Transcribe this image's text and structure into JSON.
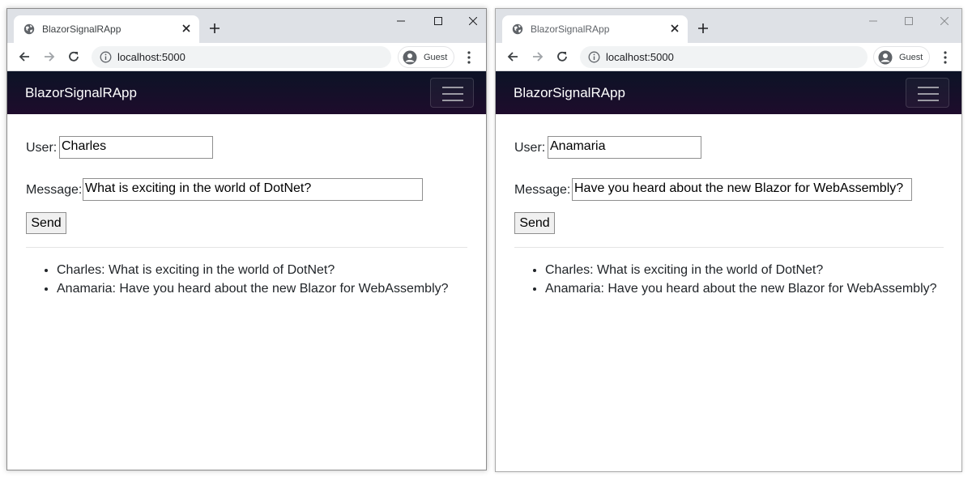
{
  "windows": [
    {
      "tab": {
        "title": "BlazorSignalRApp"
      },
      "url": "localhost:5000",
      "profile": "Guest",
      "app": {
        "brand": "BlazorSignalRApp",
        "user_label": "User:",
        "user_value": "Charles",
        "message_label": "Message:",
        "message_value": "What is exciting in the world of DotNet?",
        "send_label": "Send"
      },
      "messages": [
        "Charles: What is exciting in the world of DotNet?",
        "Anamaria: Have you heard about the new Blazor for WebAssembly?"
      ]
    },
    {
      "tab": {
        "title": "BlazorSignalRApp"
      },
      "url": "localhost:5000",
      "profile": "Guest",
      "app": {
        "brand": "BlazorSignalRApp",
        "user_label": "User:",
        "user_value": "Anamaria",
        "message_label": "Message:",
        "message_value": "Have you heard about the new Blazor for WebAssembly?",
        "send_label": "Send"
      },
      "messages": [
        "Charles: What is exciting in the world of DotNet?",
        "Anamaria: Have you heard about the new Blazor for WebAssembly?"
      ]
    }
  ],
  "colors": {
    "navbar_top": "#0c1326",
    "navbar_bottom": "#1e0c2c",
    "tabstrip": "#dee1e6",
    "omnibox": "#f1f3f4"
  },
  "icons": [
    "globe-icon",
    "close-icon",
    "plus-icon",
    "minimize-icon",
    "maximize-icon",
    "back-arrow-icon",
    "forward-arrow-icon",
    "reload-icon",
    "info-icon",
    "avatar-icon",
    "more-vert-icon",
    "hamburger-icon"
  ]
}
